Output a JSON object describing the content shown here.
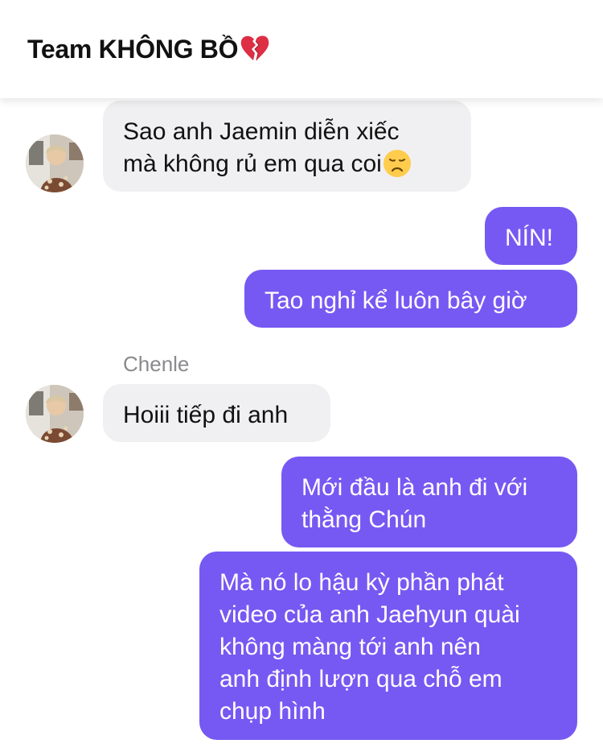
{
  "header": {
    "title": "Team KHÔNG BỒ",
    "title_emoji_icon": "broken-heart-icon",
    "colors": {
      "background": "#ffffff",
      "text": "#111111"
    }
  },
  "colors": {
    "outgoing_bubble": "#7659f2",
    "incoming_bubble": "#f0f0f2",
    "sender_name": "#8a8a8e"
  },
  "messages": [
    {
      "direction": "incoming",
      "sender_avatar": "avatar-photo",
      "lines": [
        "Sao anh Jaemin diễn xiếc",
        "mà không rủ em qua coi"
      ],
      "trailing_emoji_icon": "disappointed-face-icon"
    },
    {
      "direction": "outgoing",
      "lines": [
        "NÍN!"
      ]
    },
    {
      "direction": "outgoing",
      "lines": [
        "Tao nghỉ kể luôn bây giờ"
      ]
    },
    {
      "direction": "incoming",
      "sender_name": "Chenle",
      "sender_avatar": "avatar-photo",
      "lines": [
        "Hoiii tiếp đi anh"
      ]
    },
    {
      "direction": "outgoing",
      "lines": [
        "Mới đầu là anh đi với",
        "thằng Chún"
      ]
    },
    {
      "direction": "outgoing",
      "lines": [
        "Mà nó lo hậu kỳ phần phát",
        "video của anh Jaehyun quài",
        "không màng tới anh nên",
        "anh định lượn qua chỗ em",
        "chụp hình"
      ]
    }
  ]
}
